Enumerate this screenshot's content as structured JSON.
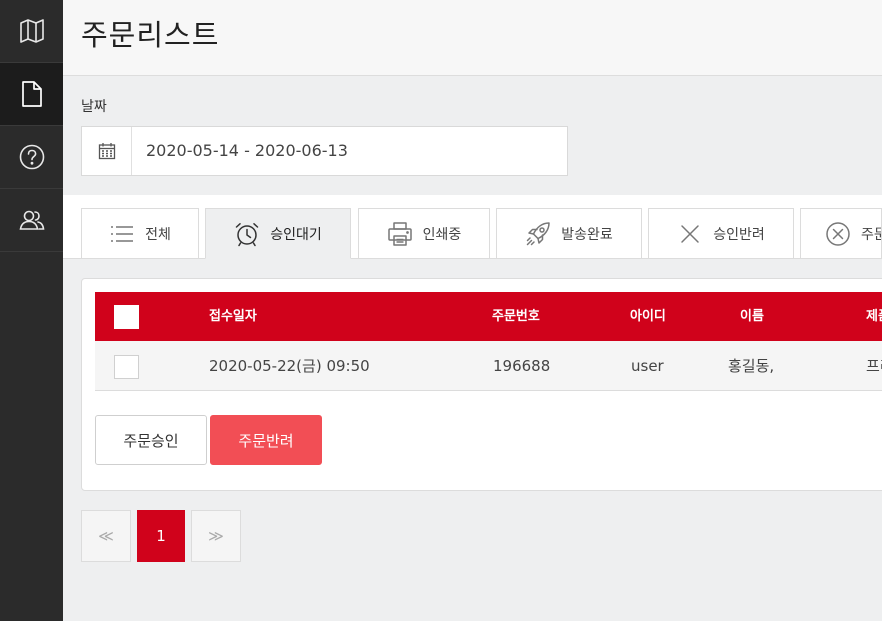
{
  "sidebar": {
    "items": [
      {
        "icon": "map-icon",
        "active": false
      },
      {
        "icon": "document-icon",
        "active": true
      },
      {
        "icon": "help-icon",
        "active": false
      },
      {
        "icon": "users-icon",
        "active": false
      }
    ]
  },
  "header": {
    "title": "주문리스트"
  },
  "filter": {
    "date_label": "날짜",
    "date_range": "2020-05-14 - 2020-06-13"
  },
  "tabs": [
    {
      "label": "전체",
      "icon": "list-icon"
    },
    {
      "label": "승인대기",
      "icon": "alarm-clock-icon",
      "active": true
    },
    {
      "label": "인쇄중",
      "icon": "printer-icon"
    },
    {
      "label": "발송완료",
      "icon": "rocket-icon"
    },
    {
      "label": "승인반려",
      "icon": "x-icon"
    },
    {
      "label": "주문",
      "icon": "x-circle-icon"
    }
  ],
  "table": {
    "headers": [
      "접수일자",
      "주문번호",
      "아이디",
      "이름",
      "제품"
    ],
    "rows": [
      {
        "date": "2020-05-22(금) 09:50",
        "order_no": "196688",
        "user_id": "user",
        "name": "홍길동,",
        "product": "프리"
      }
    ]
  },
  "actions": {
    "approve_label": "주문승인",
    "reject_label": "주문반려"
  },
  "pagination": {
    "prev": "≪",
    "current": "1",
    "next": "≫"
  },
  "colors": {
    "accent": "#d0021b",
    "reject_button": "#f24e55",
    "sidebar": "#2b2b2b"
  }
}
